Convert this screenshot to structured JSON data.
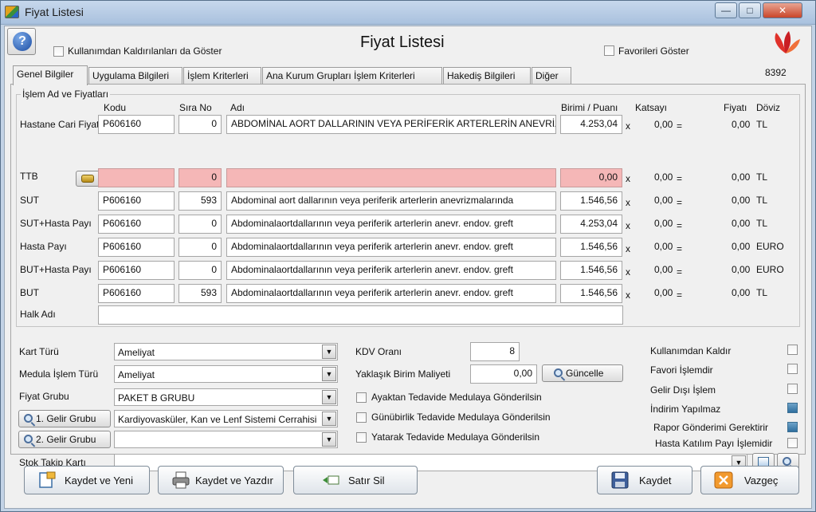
{
  "window": {
    "title": "Fiyat Listesi"
  },
  "header": {
    "show_removed_label": "Kullanımdan Kaldırılanları da Göster",
    "title": "Fiyat Listesi",
    "show_favorites_label": "Favorileri Göster",
    "record_no": "8392"
  },
  "tabs": [
    {
      "label": "Genel Bilgiler",
      "active": true
    },
    {
      "label": "Uygulama Bilgileri",
      "active": false
    },
    {
      "label": "İşlem Kriterleri",
      "active": false
    },
    {
      "label": "Ana Kurum Grupları İşlem Kriterleri",
      "active": false
    },
    {
      "label": "Hakediş Bilgileri",
      "active": false
    },
    {
      "label": "Diğer",
      "active": false
    }
  ],
  "group": {
    "title": "İşlem Ad ve Fiyatları",
    "columns": {
      "kodu": "Kodu",
      "sira": "Sıra No",
      "adi": "Adı",
      "birimi": "Birimi / Puanı",
      "katsayi": "Katsayı",
      "fiyati": "Fiyatı",
      "doviz": "Döviz"
    },
    "rows": [
      {
        "label": "Hastane Cari Fiyatı",
        "kodu": "P606160",
        "sira": "0",
        "adi": "ABDOMİNAL AORT DALLARININ VEYA PERİFERİK ARTERLERİN ANEVRİZMALARINDA",
        "birim": "4.253,04",
        "katsayi": "0,00",
        "fiyat": "0,00",
        "doviz": "TL",
        "pink": false
      },
      {
        "label": "TTB",
        "kodu": "",
        "sira": "0",
        "adi": "",
        "birim": "0,00",
        "katsayi": "0,00",
        "fiyat": "0,00",
        "doviz": "TL",
        "pink": true
      },
      {
        "label": "SUT",
        "kodu": "P606160",
        "sira": "593",
        "adi": "Abdominal aort dallarının veya periferik arterlerin anevrizmalarında",
        "birim": "1.546,56",
        "katsayi": "0,00",
        "fiyat": "0,00",
        "doviz": "TL",
        "pink": false
      },
      {
        "label": "SUT+Hasta Payı",
        "kodu": "P606160",
        "sira": "0",
        "adi": "Abdominalaortdallarının veya periferik arterlerin anevr. endov. greft",
        "birim": "4.253,04",
        "katsayi": "0,00",
        "fiyat": "0,00",
        "doviz": "TL",
        "pink": false
      },
      {
        "label": "Hasta Payı",
        "kodu": "P606160",
        "sira": "0",
        "adi": "Abdominalaortdallarının veya periferik arterlerin anevr. endov. greft",
        "birim": "1.546,56",
        "katsayi": "0,00",
        "fiyat": "0,00",
        "doviz": "EURO",
        "pink": false
      },
      {
        "label": "BUT+Hasta Payı",
        "kodu": "P606160",
        "sira": "0",
        "adi": "Abdominalaortdallarının veya periferik arterlerin anevr. endov. greft",
        "birim": "1.546,56",
        "katsayi": "0,00",
        "fiyat": "0,00",
        "doviz": "EURO",
        "pink": false
      },
      {
        "label": "BUT",
        "kodu": "P606160",
        "sira": "593",
        "adi": "Abdominalaortdallarının veya periferik arterlerin anevr. endov. greft",
        "birim": "1.546,56",
        "katsayi": "0,00",
        "fiyat": "0,00",
        "doviz": "TL",
        "pink": false
      }
    ],
    "x_sign": "x",
    "eq_sign": "=",
    "halk_adi_label": "Halk Adı",
    "halk_adi_value": ""
  },
  "form": {
    "kart_turu_label": "Kart Türü",
    "kart_turu_value": "Ameliyat",
    "medula_label": "Medula İşlem Türü",
    "medula_value": "Ameliyat",
    "fiyat_grubu_label": "Fiyat Grubu",
    "fiyat_grubu_value": "PAKET B GRUBU",
    "gelir1_button": "1. Gelir Grubu",
    "gelir1_value": "Kardiyovasküler, Kan ve Lenf Sistemi Cerrahisi",
    "gelir2_button": "2. Gelir Grubu",
    "gelir2_value": "",
    "stok_label": "Stok Takip Kartı",
    "stok_value": "",
    "kdv_label": "KDV Oranı",
    "kdv_value": "8",
    "maliyet_label": "Yaklaşık Birim  Maliyeti",
    "maliyet_value": "0,00",
    "guncelle_button": "Güncelle",
    "ayaktan_label": "Ayaktan Tedavide Medulaya Gönderilsin",
    "gunubirlik_label": "Günübirlik Tedavide Medulaya Gönderilsin",
    "yatarak_label": "Yatarak Tedavide Medulaya Gönderilsin"
  },
  "flags": [
    {
      "label": "Kullanımdan Kaldır",
      "checked": false
    },
    {
      "label": "Favori İşlemdir",
      "checked": false
    },
    {
      "label": "Gelir Dışı İşlem",
      "checked": false
    },
    {
      "label": "İndirim Yapılmaz",
      "checked": true
    },
    {
      "label": "Rapor Gönderimi Gerektirir",
      "checked": true
    },
    {
      "label": "Hasta Katılım Payı İşlemidir",
      "checked": false
    }
  ],
  "buttons": {
    "kaydet_yeni": "Kaydet ve Yeni",
    "kaydet_yazdir": "Kaydet ve Yazdır",
    "satir_sil": "Satır Sil",
    "kaydet": "Kaydet",
    "vazgec": "Vazgeç"
  },
  "colors": {
    "pink_field": "#f5b7b7",
    "checked_box": "#2f6f9e"
  }
}
